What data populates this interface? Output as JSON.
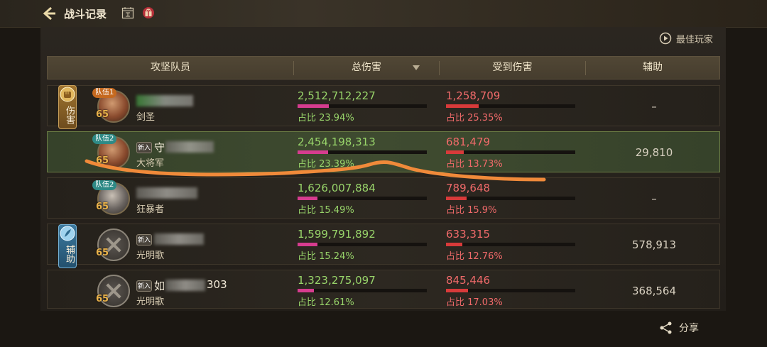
{
  "header": {
    "title": "战斗记录"
  },
  "best_player_label": "最佳玩家",
  "columns": {
    "member": "攻坚队员",
    "total_damage": "总伤害",
    "damage_taken": "受到伤害",
    "assist": "辅助"
  },
  "roles": {
    "damage": "伤害",
    "support": "辅助"
  },
  "rows": [
    {
      "team": "队伍1",
      "level": "65",
      "newbie": "",
      "name_visible": "",
      "job": "剑圣",
      "total_damage": "2,512,712,227",
      "damage_share": "占比 23.94%",
      "damage_share_value": 23.94,
      "damage_taken": "1,258,709",
      "taken_share": "占比 25.35%",
      "taken_share_value": 25.35,
      "assist": "–"
    },
    {
      "team": "队伍2",
      "level": "65",
      "newbie": "新入",
      "name_visible": "守",
      "job": "大将军",
      "total_damage": "2,454,198,313",
      "damage_share": "占比 23.39%",
      "damage_share_value": 23.39,
      "damage_taken": "681,479",
      "taken_share": "占比 13.73%",
      "taken_share_value": 13.73,
      "assist": "29,810"
    },
    {
      "team": "队伍2",
      "level": "65",
      "newbie": "",
      "name_visible": "",
      "job": "狂暴者",
      "total_damage": "1,626,007,884",
      "damage_share": "占比 15.49%",
      "damage_share_value": 15.49,
      "damage_taken": "789,648",
      "taken_share": "占比 15.9%",
      "taken_share_value": 15.9,
      "assist": "–"
    },
    {
      "team": "",
      "level": "65",
      "newbie": "新入",
      "name_visible": "",
      "job": "光明歌",
      "total_damage": "1,599,791,892",
      "damage_share": "占比 15.24%",
      "damage_share_value": 15.24,
      "damage_taken": "633,315",
      "taken_share": "占比 12.76%",
      "taken_share_value": 12.76,
      "assist": "578,913"
    },
    {
      "team": "",
      "level": "65",
      "newbie": "新入",
      "name_visible": "如",
      "name_suffix": "303",
      "job": "光明歌",
      "total_damage": "1,323,275,097",
      "damage_share": "占比 12.61%",
      "damage_share_value": 12.61,
      "damage_taken": "845,446",
      "taken_share": "占比 17.03%",
      "taken_share_value": 17.03,
      "assist": "368,564"
    }
  ],
  "share_label": "分享",
  "colors": {
    "damage_green": "#98d46a",
    "taken_red": "#f06a6a",
    "damage_bar": "#d63c8f",
    "highlight_row": "#3f4b30",
    "annotation_stroke": "#f08a3a"
  },
  "icons": [
    "back-arrow-icon",
    "calendar-icon",
    "gift-icon",
    "play-circle-icon",
    "fist-icon",
    "feather-icon",
    "share-icon",
    "sort-down-icon"
  ]
}
